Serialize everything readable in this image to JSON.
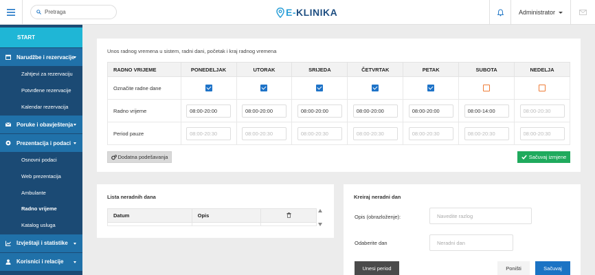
{
  "header": {
    "search_placeholder": "Pretraga",
    "logo_prefix": "E-",
    "logo_main": "KLINIKA",
    "user_label": "Administrator",
    "icons": {
      "menu": "hamburger-icon",
      "search": "search-icon",
      "logo": "location-pin-icon",
      "notifications": "bell-icon",
      "messages": "mail-icon"
    }
  },
  "sidebar": {
    "start_label": "START",
    "sections": [
      {
        "label": "Narudžbe i rezervacije",
        "icon": "calendar-icon",
        "items": [
          "Zahtjevi za rezervaciju",
          "Potvrđene rezervacije",
          "Kalendar rezervacija"
        ]
      },
      {
        "label": "Poruke i obavještenja",
        "icon": "mail-icon",
        "items": []
      },
      {
        "label": "Prezentacija i podaci",
        "icon": "globe-icon",
        "items": [
          "Osnovni podaci",
          "Web prezentacija",
          "Ambulante",
          "Radno vrijeme",
          "Katalog usluga"
        ]
      },
      {
        "label": "Izvještaji i statistike",
        "icon": "chart-icon",
        "items": []
      },
      {
        "label": "Korisnici i relacije",
        "icon": "user-icon",
        "items": []
      }
    ],
    "active_item": "Radno vrijeme"
  },
  "schedule": {
    "title": "Unos radnog vremena u sistem, radni dani, početak i kraj radnog vremena",
    "header_first": "RADNO VRIJEME",
    "days": [
      "PONEDELJAK",
      "UTORAK",
      "SRIJEDA",
      "ČETVRTAK",
      "PETAK",
      "SUBOTA",
      "NEDELJA"
    ],
    "row_labels": {
      "workdays": "Označite radne dane",
      "hours": "Radno vrijeme",
      "pause": "Period pauze"
    },
    "workdays_checked": [
      true,
      true,
      true,
      true,
      true,
      false,
      false
    ],
    "hours_values": [
      "08:00-20:00",
      "08:00-20:00",
      "08:00-20:00",
      "08:00-20:00",
      "08:00-20:00",
      "08:00-14:00",
      ""
    ],
    "hours_placeholder": "08:00-20:30",
    "pause_placeholder": "08:00-20:30",
    "colors": {
      "checked": "#1e73c8",
      "unchecked_border": "#ef7b35"
    },
    "advanced_button": "Dodatna podešavanja",
    "save_button": "Sačuvaj izmjene"
  },
  "nonworking_list": {
    "title": "Lista neradnih dana",
    "columns": [
      "Datum",
      "Opis"
    ],
    "delete_icon": "trash-icon"
  },
  "create_nonworking": {
    "title": "Kreiraj neradni dan",
    "reason_label": "Opis (obrazloženje):",
    "reason_placeholder": "Navedite razlog",
    "date_label": "Odaberite dan",
    "date_placeholder": "Neradni dan",
    "period_button": "Unesi period",
    "cancel_button": "Poništi",
    "save_button": "Sačuvaj"
  }
}
